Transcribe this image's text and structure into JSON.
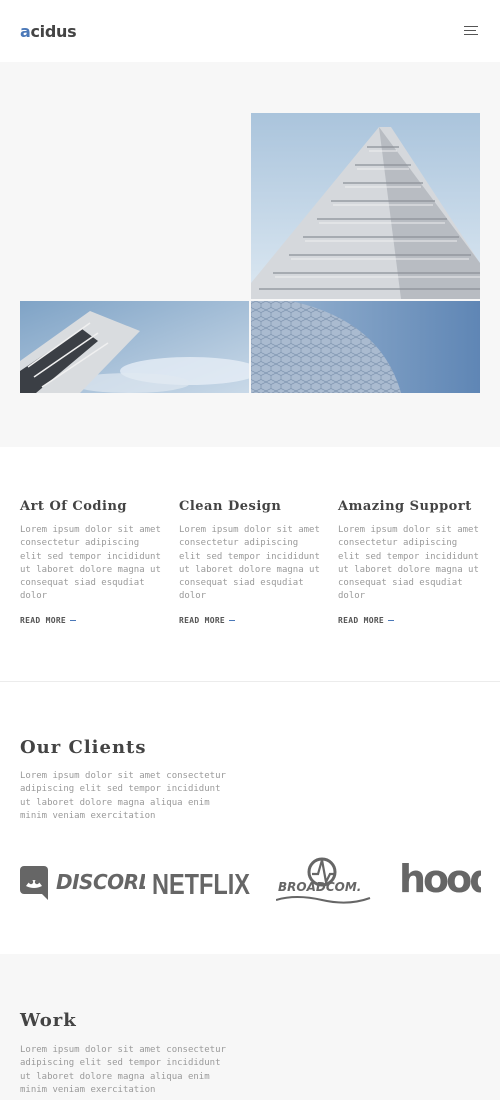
{
  "header": {
    "logo_accent": "a",
    "logo_rest": "cidus",
    "menu_icon": "hamburger-icon"
  },
  "colors": {
    "accent": "#4a78b8",
    "heading": "#444444",
    "body_text": "#9a9a9a",
    "light_section": "#f7f7f7"
  },
  "features": [
    {
      "title": "Art Of Coding",
      "text": "Lorem ipsum dolor sit amet consectetur adipiscing elit sed tempor incididunt ut laboret dolore magna ut consequat siad esqudiat dolor",
      "link": "READ MORE"
    },
    {
      "title": "Clean Design",
      "text": "Lorem ipsum dolor sit amet consectetur adipiscing elit sed tempor incididunt ut laboret dolore magna ut consequat siad esqudiat dolor",
      "link": "READ MORE"
    },
    {
      "title": "Amazing Support",
      "text": "Lorem ipsum dolor sit amet consectetur adipiscing elit sed tempor incididunt ut laboret dolore magna ut consequat siad esqudiat dolor",
      "link": "READ MORE"
    }
  ],
  "clients": {
    "title": "Our Clients",
    "text": "Lorem ipsum dolor sit amet consectetur adipiscing elit sed tempor incididunt ut laboret dolore magna aliqua enim minim veniam exercitation",
    "logos": [
      "DISCORD",
      "NETFLIX",
      "BROADCOM.",
      "hooq"
    ]
  },
  "work": {
    "title": "Work",
    "text": "Lorem ipsum dolor sit amet consectetur adipiscing elit sed tempor incididunt ut laboret dolore magna aliqua enim minim veniam exercitation"
  }
}
